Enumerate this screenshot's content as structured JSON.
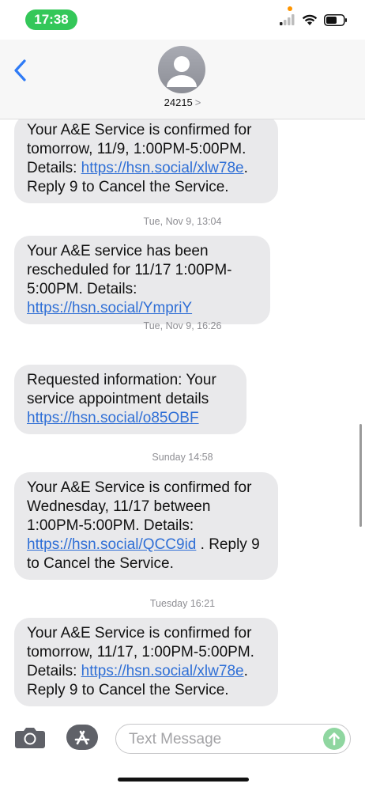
{
  "status_bar": {
    "time": "17:38"
  },
  "header": {
    "contact_number": "24215",
    "contact_chevron": ">"
  },
  "messages": [
    {
      "type": "bubble",
      "parts": [
        "Your A&E Service is confirmed for tomorrow, 11/9, 1:00PM-5:00PM. Details: ",
        {
          "link": "https://hsn.social/xlw78e"
        },
        ". Reply 9 to Cancel the Service."
      ]
    },
    {
      "type": "timestamp",
      "text": "Tue, Nov 9, 13:04"
    },
    {
      "type": "bubble",
      "parts": [
        "Your A&E service has been rescheduled for 11/17 1:00PM-5:00PM. Details: ",
        {
          "link": "https://hsn.social/YmpriY"
        }
      ]
    },
    {
      "type": "timestamp",
      "text": "Tue, Nov 9, 16:26"
    },
    {
      "type": "bubble",
      "parts": [
        "Requested information:  Your service appointment details ",
        {
          "link": "https://hsn.social/o85OBF"
        }
      ]
    },
    {
      "type": "timestamp",
      "text": "Sunday 14:58"
    },
    {
      "type": "bubble",
      "parts": [
        "Your A&E Service is confirmed for Wednesday, 11/17 between 1:00PM-5:00PM. Details: ",
        {
          "link": "https://hsn.social/QCC9id"
        },
        " . Reply 9 to Cancel the Service."
      ]
    },
    {
      "type": "timestamp",
      "text": "Tuesday 16:21"
    },
    {
      "type": "bubble",
      "parts": [
        "Your A&E Service is confirmed for tomorrow, 11/17, 1:00PM-5:00PM. Details: ",
        {
          "link": "https://hsn.social/xlw78e"
        },
        ". Reply 9 to Cancel the Service."
      ]
    }
  ],
  "input_bar": {
    "placeholder": "Text Message"
  },
  "colors": {
    "bubble": "#e9e9eb",
    "link": "#2f6fd6",
    "time_pill": "#34c759",
    "back": "#2f7bf6"
  },
  "icons": [
    "back-chevron-icon",
    "contact-avatar-icon",
    "camera-icon",
    "app-store-icon",
    "send-arrow-icon",
    "signal-icon",
    "wifi-icon",
    "battery-icon"
  ]
}
